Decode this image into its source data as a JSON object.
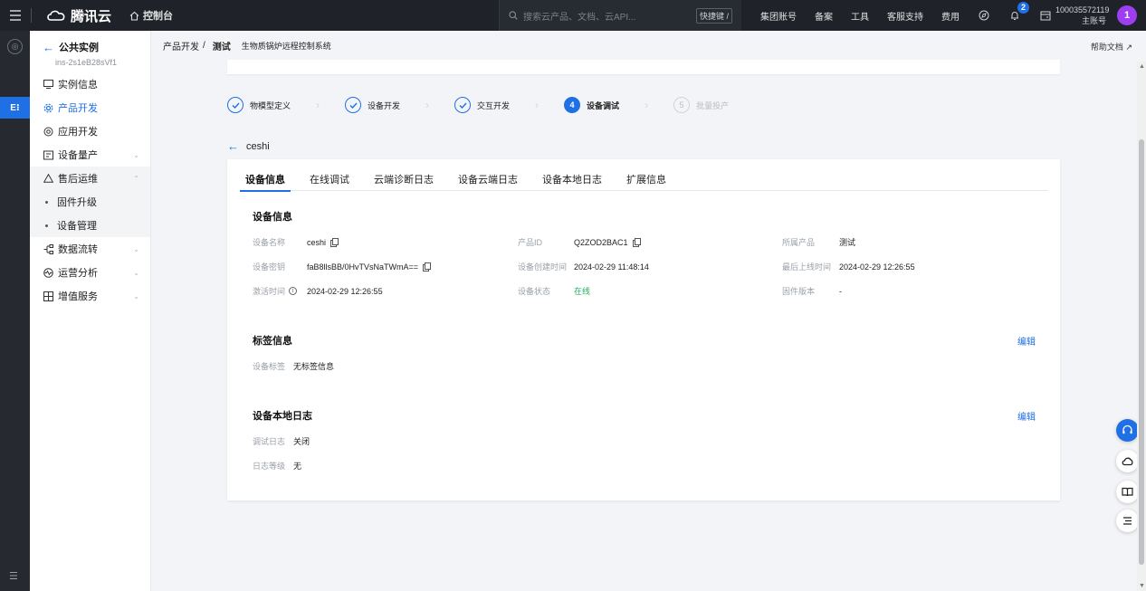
{
  "topbar": {
    "brand": "腾讯云",
    "console": "控制台",
    "search_placeholder": "搜索云产品、文档、云API...",
    "search_shortcut": "快捷键 /",
    "nav": [
      "集团账号",
      "备案",
      "工具",
      "客服支持",
      "费用"
    ],
    "notification_count": "2",
    "account_id": "100035572119",
    "account_role": "主账号",
    "avatar_letter": "1"
  },
  "sidebar": {
    "title": "公共实例",
    "instance_id": "ins-2s1eB28sVf1",
    "items": [
      {
        "label": "实例信息"
      },
      {
        "label": "产品开发"
      },
      {
        "label": "应用开发"
      },
      {
        "label": "设备量产"
      },
      {
        "label": "售后运维"
      },
      {
        "label": "固件升级"
      },
      {
        "label": "设备管理"
      },
      {
        "label": "数据流转"
      },
      {
        "label": "运营分析"
      },
      {
        "label": "增值服务"
      }
    ]
  },
  "breadcrumb": {
    "root": "产品开发",
    "separator": "/",
    "current": "测试",
    "project": "生物质锅炉远程控制系统"
  },
  "help_doc": "帮助文档",
  "steps": [
    {
      "label": "物模型定义",
      "state": "done"
    },
    {
      "label": "设备开发",
      "state": "done"
    },
    {
      "label": "交互开发",
      "state": "done"
    },
    {
      "label": "设备调试",
      "state": "active",
      "num": "4"
    },
    {
      "label": "批量投产",
      "state": "pending",
      "num": "5"
    }
  ],
  "device_name_header": "ceshi",
  "tabs": [
    "设备信息",
    "在线调试",
    "云端诊断日志",
    "设备云端日志",
    "设备本地日志",
    "扩展信息"
  ],
  "device_info": {
    "section_title": "设备信息",
    "fields": [
      {
        "key": "设备名称",
        "value": "ceshi"
      },
      {
        "key": "产品ID",
        "value": "Q2ZOD2BAC1"
      },
      {
        "key": "所属产品",
        "value": "测试"
      },
      {
        "key": "设备密钥",
        "value": "faB8llsBB/0HvTVsNaTWmA=="
      },
      {
        "key": "设备创建时间",
        "value": "2024-02-29 11:48:14"
      },
      {
        "key": "最后上线时间",
        "value": "2024-02-29 12:26:55"
      },
      {
        "key": "激活时间",
        "value": "2024-02-29 12:26:55"
      },
      {
        "key": "设备状态",
        "value": "在线"
      },
      {
        "key": "固件版本",
        "value": "-"
      }
    ]
  },
  "tag_info": {
    "section_title": "标签信息",
    "edit_label": "编辑",
    "key": "设备标签",
    "value": "无标签信息"
  },
  "local_log": {
    "section_title": "设备本地日志",
    "edit_label": "编辑",
    "debug_key": "调试日志",
    "debug_value": "关闭",
    "level_key": "日志等级",
    "level_value": "无"
  },
  "colors": {
    "accent": "#1f6fe5",
    "online": "#27ae60",
    "topbar": "#1f2329"
  }
}
